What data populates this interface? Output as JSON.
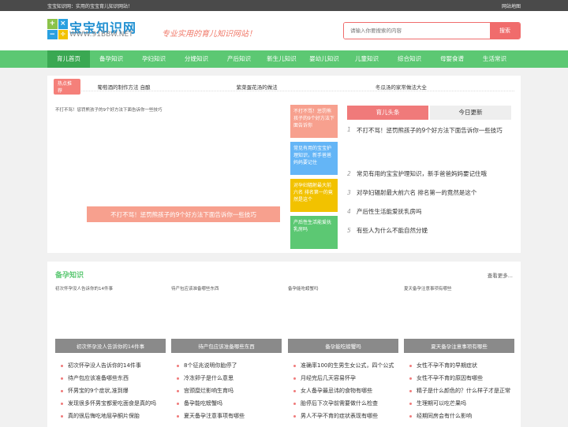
{
  "topbar": {
    "left": "宝宝知识网：实用的宝宝育儿知识网站！",
    "right": "网站地图"
  },
  "logo": {
    "cn": "宝宝知识网",
    "url": "WWW.91BBW.NET",
    "grid": [
      "+",
      "×",
      "−",
      "÷"
    ]
  },
  "slogan": "专业实用的育儿知识网站！",
  "search": {
    "placeholder": "请输入你要搜索的内容",
    "button": "搜索"
  },
  "nav": [
    "育儿首页",
    "备孕知识",
    "孕妇知识",
    "分娩知识",
    "产后知识",
    "新生儿知识",
    "婴幼儿知识",
    "儿童知识",
    "综合知识",
    "母婴食谱",
    "生活常识"
  ],
  "hot": {
    "badge": "热点推荐",
    "items": [
      "葡萄酒的制作方法 自酿",
      "紫菜蛋花汤的做法",
      "冬瓜汤的家常做法大全"
    ]
  },
  "hero": {
    "alt": "不打不骂！惩罚熊孩子的9个好方法下面告诉你一些技巧",
    "caption": "不打不骂！惩罚熊孩子的9个好方法下面告诉你一些技巧"
  },
  "tiles": [
    {
      "text": "不打不骂！惩罚熊孩子的9个好方法下面告诉你",
      "color": "#f7a08e"
    },
    {
      "text": "常见有用的宝宝护理知识，新手爸爸妈妈要记住",
      "color": "#64b5f6"
    },
    {
      "text": "对孕妇辐射最大前六名 排名第一的竟然是这个",
      "color": "#f2c200"
    },
    {
      "text": "产后性生活能爱抚乳房吗",
      "color": "#5cc873"
    }
  ],
  "tabs": [
    "育儿头条",
    "今日更新"
  ],
  "toplist": [
    {
      "n": "1",
      "t": "不打不骂！惩罚熊孩子的9个好方法下面告诉你一些技巧"
    },
    {
      "n": "2",
      "t": "常见有用的宝宝护理知识，新手爸爸妈妈要记住哦"
    },
    {
      "n": "3",
      "t": "对孕妇辐射最大前六名 排名第一的竟然是这个"
    },
    {
      "n": "4",
      "t": "产后性生活能爱抚乳房吗"
    },
    {
      "n": "5",
      "t": "有些人为什么不能自然分娩"
    }
  ],
  "sec2": {
    "title": "备孕知识",
    "more": "查看更多..."
  },
  "cols": [
    {
      "alt": "初次怀孕没人告诉你的14件事",
      "cap": "初次怀孕没人告诉你的14件事",
      "items": [
        "初次怀孕没人告诉你的14件事",
        "待产包应该准备哪些东西",
        "怀男宝的9个症状,准到爆",
        "发现很多怀男宝都爱吃面食是真的吗",
        "真的很后悔吃地屈孕酮片保胎"
      ]
    },
    {
      "alt": "待产包应该准备哪些东西",
      "cap": "待产包应该准备哪些东西",
      "items": [
        "8个征兆说明你胎停了",
        "冷冻卵子是什么意思",
        "宫颈糜烂影响生育吗",
        "备孕能吃螃蟹吗",
        "夏天备孕注意事项有哪些"
      ]
    },
    {
      "alt": "备孕能吃螃蟹吗",
      "cap": "备孕能吃螃蟹吗",
      "items": [
        "准确率100的生男生女公式，四个公式",
        "月经完后几天容易怀孕",
        "女人备孕最忌讳的食物有哪些",
        "胎停后下次孕前需要做什么检查",
        "男人不孕不育的症状表现有哪些"
      ]
    },
    {
      "alt": "夏天备孕注意事项有哪些",
      "cap": "夏天备孕注意事项有哪些",
      "items": [
        "女性不孕不育的早期症状",
        "女性不孕不育的原因有哪些",
        "精子是什么颜色的？什么样子才是正常",
        "生理期可以吃芒果吗",
        "经期同房会有什么影响"
      ]
    }
  ]
}
